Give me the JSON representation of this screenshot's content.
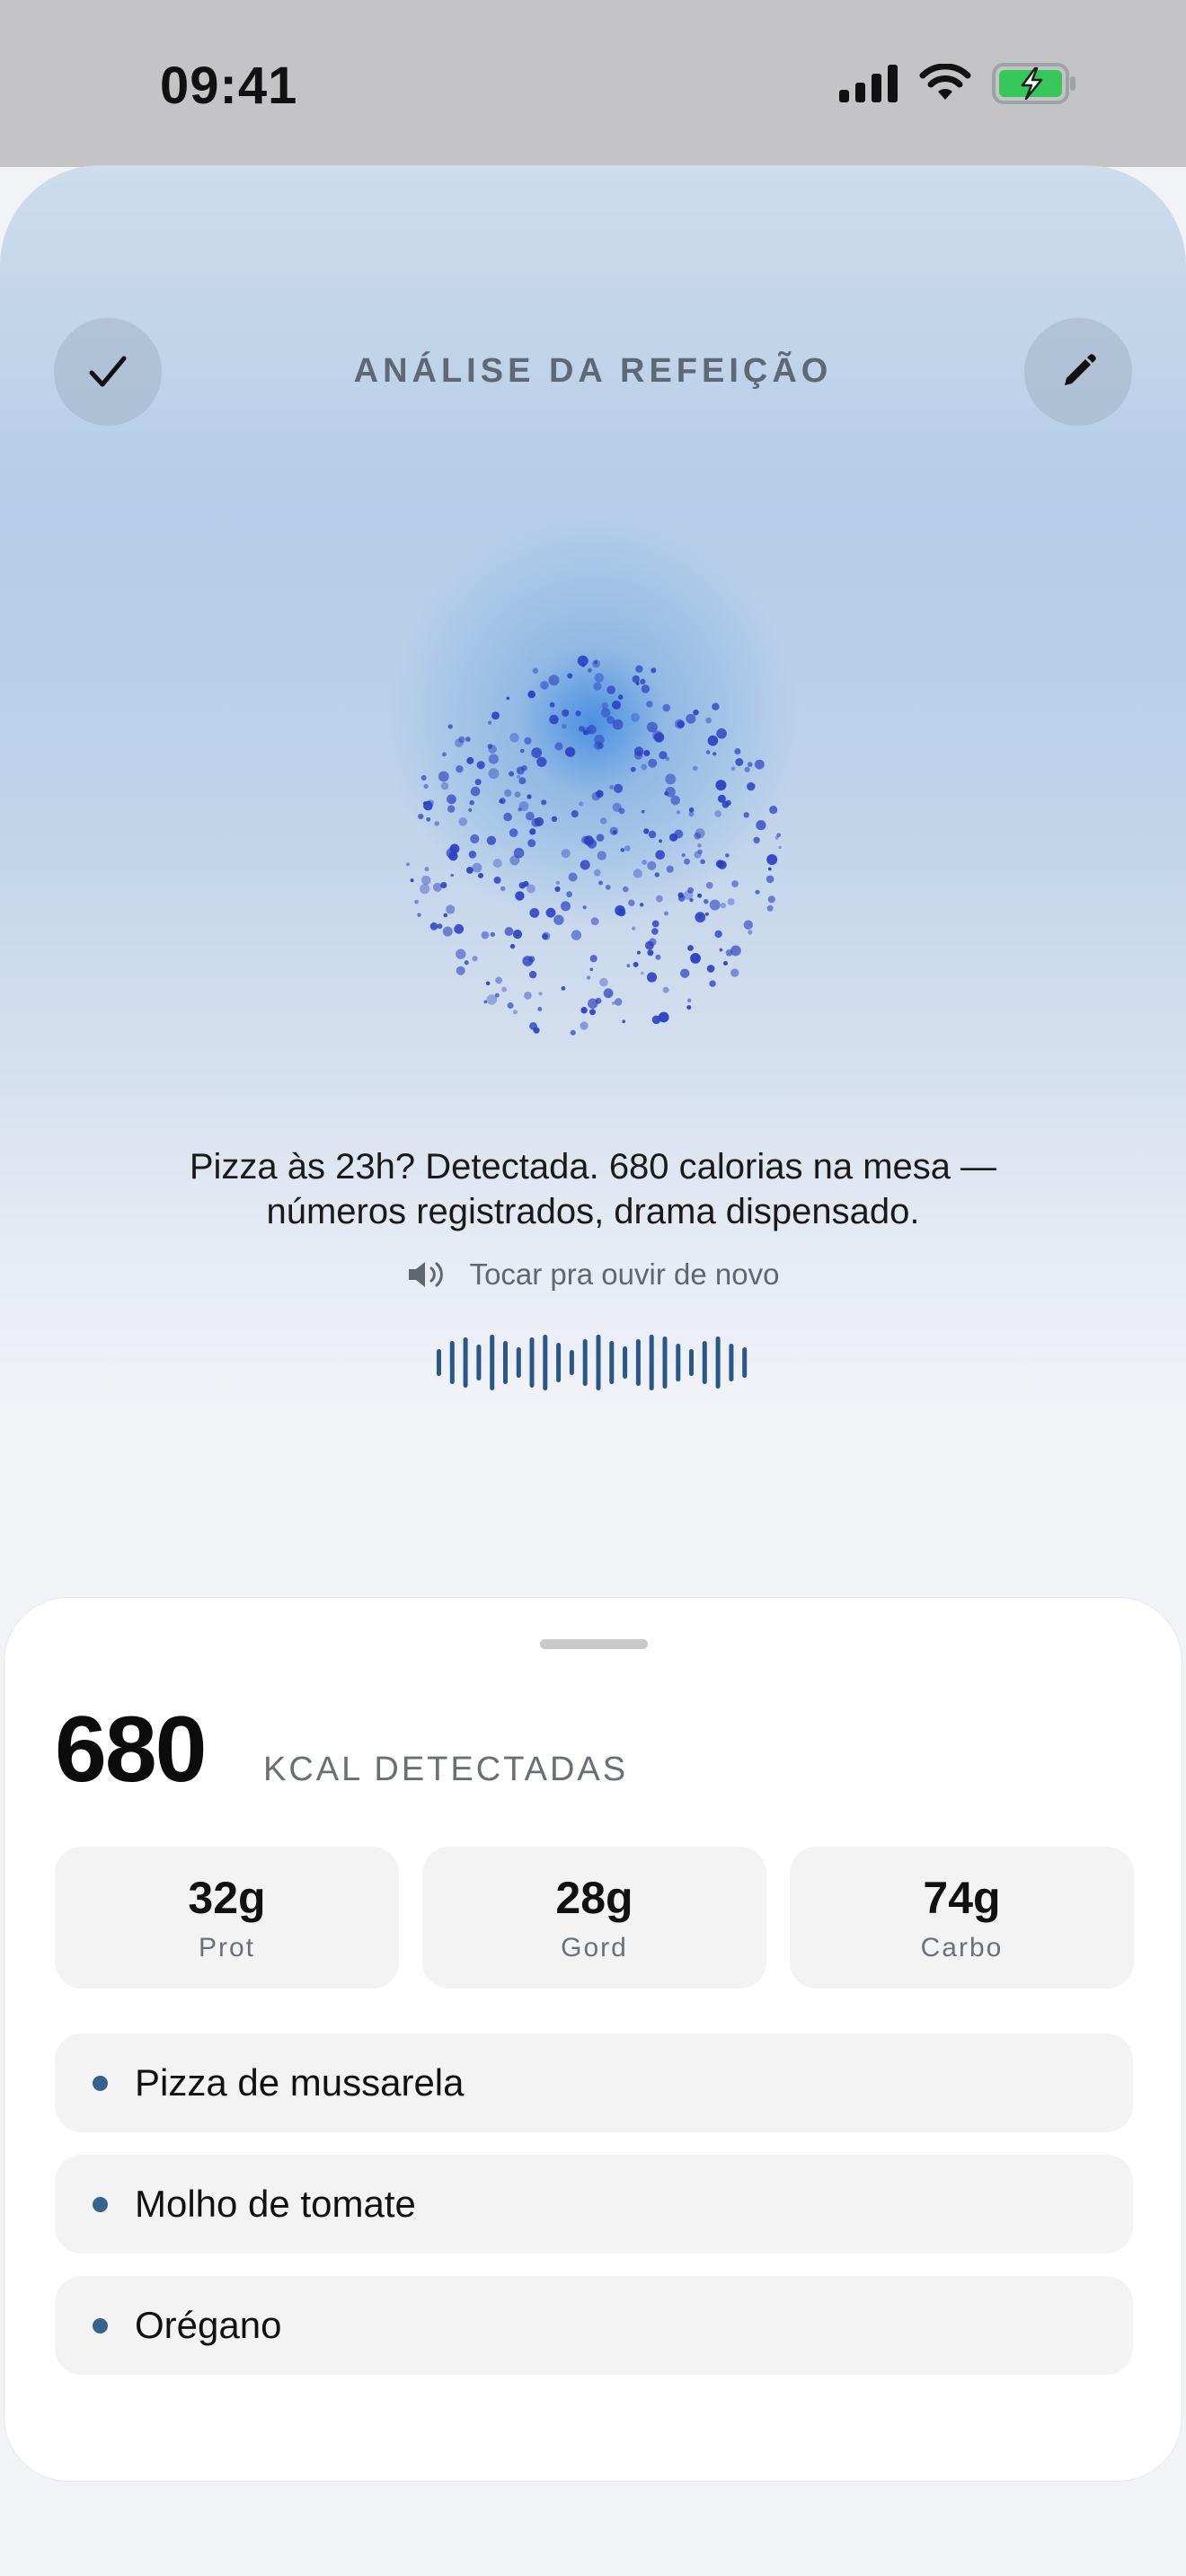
{
  "status_bar": {
    "time": "09:41",
    "icons": [
      "signal-icon",
      "wifi-icon",
      "battery-charging-icon"
    ]
  },
  "header": {
    "title": "ANÁLISE DA REFEIÇÃO",
    "left_icon": "check-icon",
    "right_icon": "pencil-icon"
  },
  "analysis": {
    "caption_line1": "Pizza às 23h? Detectada. 680 calorias na mesa —",
    "caption_line2": "números registrados, drama dispensado.",
    "replay_label": "Tocar pra ouvir de novo",
    "replay_icon": "speaker-icon"
  },
  "summary": {
    "kcal_value": "680",
    "kcal_label": "KCAL DETECTADAS",
    "macros": [
      {
        "value": "32g",
        "label": "Prot"
      },
      {
        "value": "28g",
        "label": "Gord"
      },
      {
        "value": "74g",
        "label": "Carbo"
      }
    ],
    "items": [
      {
        "label": "Pizza de mussarela"
      },
      {
        "label": "Molho de tomate"
      },
      {
        "label": "Orégano"
      }
    ]
  },
  "colors": {
    "accent": "#37628f",
    "orb_dots": "#2a3fc0",
    "waveform": "#2b5688"
  }
}
